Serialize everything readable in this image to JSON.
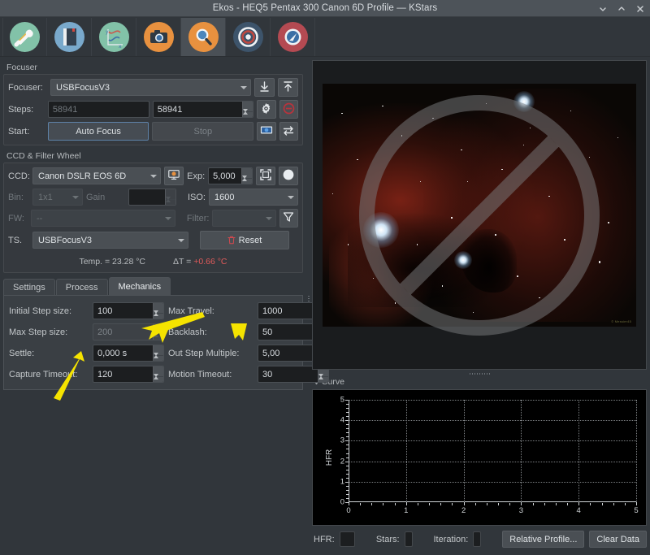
{
  "window": {
    "title": "Ekos - HEQ5 Pentax 300 Canon 6D Profile — KStars",
    "controls": [
      {
        "name": "minimize",
        "glyph": "⌄"
      },
      {
        "name": "maximize",
        "glyph": "⌃"
      },
      {
        "name": "close",
        "glyph": "✕"
      }
    ]
  },
  "toolbar": {
    "items": [
      {
        "name": "setup-tab",
        "icon": "wrench-screwdriver-icon",
        "bg": "#82c2a8",
        "active": false
      },
      {
        "name": "scheduler-tab",
        "icon": "notebook-icon",
        "bg": "#79a9cc",
        "active": false
      },
      {
        "name": "analyze-tab",
        "icon": "graph-icon",
        "bg": "#82c2a8",
        "active": false
      },
      {
        "name": "capture-tab",
        "icon": "camera-icon",
        "bg": "#e8913f",
        "active": false
      },
      {
        "name": "focus-tab",
        "icon": "magnifier-icon",
        "bg": "#e8913f",
        "active": true
      },
      {
        "name": "align-tab",
        "icon": "target-icon",
        "bg": "#3d546b",
        "active": false
      },
      {
        "name": "guide-tab",
        "icon": "guide-icon",
        "bg": "#b44a52",
        "active": false
      }
    ]
  },
  "focuser": {
    "group_title": "Focuser",
    "device_label": "Focuser:",
    "device_value": "USBFocusV3",
    "focus_in_icon": "arrow-down-to-line-icon",
    "focus_out_icon": "arrow-up-to-line-icon",
    "steps_label": "Steps:",
    "steps_position": "58941",
    "steps_target": "58941",
    "settings_icon": "gear-icon",
    "stop_icon": "stop-circle-icon",
    "start_label": "Start:",
    "auto_focus_label": "Auto Focus",
    "stop_label": "Stop",
    "capture_icon": "capture-frame-icon",
    "loop_icon": "loop-arrows-icon"
  },
  "ccd": {
    "group_title": "CCD & Filter Wheel",
    "ccd_label": "CCD:",
    "ccd_value": "Canon DSLR EOS 6D",
    "ccd_settings_icon": "ccd-settings-icon",
    "exp_label": "Exp:",
    "exp_value": "5,000",
    "frame_icon": "select-frame-icon",
    "dark_icon": "dark-frame-icon",
    "bin_label": "Bin:",
    "bin_value": "1x1",
    "gain_label": "Gain",
    "gain_value": "",
    "iso_label": "ISO:",
    "iso_value": "1600",
    "fw_label": "FW:",
    "fw_value": "--",
    "filter_label": "Filter:",
    "filter_value": "",
    "filter_icon": "funnel-icon",
    "ts_label": "TS.",
    "ts_value": "USBFocusV3",
    "reset_label": "Reset",
    "reset_icon": "trash-icon",
    "temp_text": "Temp. = 23.28 °C",
    "delta_prefix": "ΔT = ",
    "delta_value": "+0.66 °C"
  },
  "tabs": [
    {
      "name": "tab-settings",
      "label": "Settings",
      "mnemonic": "t",
      "active": false
    },
    {
      "name": "tab-process",
      "label": "Process",
      "mnemonic": "P",
      "active": false
    },
    {
      "name": "tab-mechanics",
      "label": "Mechanics",
      "mnemonic": "M",
      "active": true
    }
  ],
  "mechanics": {
    "fields": [
      {
        "name": "initial-step-size",
        "label": "Initial Step size:",
        "value": "100",
        "disabled": false
      },
      {
        "name": "max-travel",
        "label": "Max Travel:",
        "value": "1000",
        "disabled": false
      },
      {
        "name": "max-step-size",
        "label": "Max Step size:",
        "value": "200",
        "disabled": true
      },
      {
        "name": "backlash",
        "label": "Backlash:",
        "value": "50",
        "disabled": false
      },
      {
        "name": "settle",
        "label": "Settle:",
        "value": "0,000 s",
        "disabled": false
      },
      {
        "name": "out-step-multiple",
        "label": "Out Step Multiple:",
        "value": "5,00",
        "disabled": false
      },
      {
        "name": "capture-timeout",
        "label": "Capture Timeout:",
        "value": "120",
        "disabled": false
      },
      {
        "name": "motion-timeout",
        "label": "Motion Timeout:",
        "value": "30",
        "disabled": false
      }
    ]
  },
  "preview": {
    "name": "image-preview",
    "overlay_icon": "no-entry-sign-icon",
    "watermark": "© Messier45"
  },
  "vcurve": {
    "label": "V-Curve",
    "hfr_label": "HFR:",
    "hfr_value": "",
    "stars_label": "Stars:",
    "stars_value": "",
    "iteration_label": "Iteration:",
    "iteration_value": "",
    "relative_profile_label": "Relative Profile...",
    "clear_data_label": "Clear Data"
  },
  "chart_data": {
    "type": "scatter",
    "title": "V-Curve",
    "xlabel": "",
    "ylabel": "HFR",
    "x": [],
    "values": [],
    "series": [
      {
        "name": "HFR",
        "values": []
      }
    ],
    "xlim": [
      0,
      5
    ],
    "ylim": [
      0,
      5
    ],
    "xticks": [
      0,
      1,
      2,
      3,
      4,
      5
    ],
    "yticks": [
      0,
      1,
      2,
      3,
      4,
      5
    ],
    "xticklabels": [
      "0",
      "1",
      "2",
      "3",
      "4",
      "5"
    ],
    "yticklabels": [
      "0",
      "1",
      "2",
      "3",
      "4",
      "5"
    ],
    "grid": true,
    "legend": false,
    "background": "#000000",
    "axis_color": "#cfd3d6"
  },
  "annotations": {
    "accent": "#f5e300",
    "arrows": [
      {
        "name": "arrow-to-mechanics-tab",
        "points_to": "Mechanics tab"
      },
      {
        "name": "arrow-down-marker",
        "points_to": "Max Travel column"
      },
      {
        "name": "arrow-to-initial-step",
        "points_to": "Initial Step size field"
      }
    ]
  }
}
